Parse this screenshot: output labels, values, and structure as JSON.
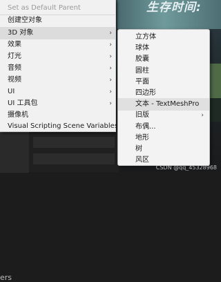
{
  "scene": {
    "title_text": "生存时间:"
  },
  "bottom_panel": {
    "label": "ers"
  },
  "watermark": "CSDN @qq_45328968",
  "main_menu": {
    "items": [
      {
        "label": "Set as Default Parent",
        "disabled": true,
        "has_submenu": false
      },
      {
        "label": "创建空对象",
        "disabled": false,
        "has_submenu": false
      },
      {
        "label": "3D 对象",
        "disabled": false,
        "has_submenu": true,
        "active": true
      },
      {
        "label": "效果",
        "disabled": false,
        "has_submenu": true
      },
      {
        "label": "灯光",
        "disabled": false,
        "has_submenu": true
      },
      {
        "label": "音频",
        "disabled": false,
        "has_submenu": true
      },
      {
        "label": "视频",
        "disabled": false,
        "has_submenu": true
      },
      {
        "label": "UI",
        "disabled": false,
        "has_submenu": true
      },
      {
        "label": "UI 工具包",
        "disabled": false,
        "has_submenu": true
      },
      {
        "label": "摄像机",
        "disabled": false,
        "has_submenu": false
      },
      {
        "label": "Visual Scripting Scene Variables",
        "disabled": false,
        "has_submenu": false
      }
    ],
    "submenu_arrow": "›"
  },
  "sub_menu": {
    "items": [
      {
        "label": "立方体",
        "has_submenu": false
      },
      {
        "label": "球体",
        "has_submenu": false
      },
      {
        "label": "胶囊",
        "has_submenu": false
      },
      {
        "label": "圆柱",
        "has_submenu": false
      },
      {
        "label": "平面",
        "has_submenu": false
      },
      {
        "label": "四边形",
        "has_submenu": false
      },
      {
        "label": "文本 - TextMeshPro",
        "has_submenu": false,
        "hover": true
      },
      {
        "label": "旧版",
        "has_submenu": true
      },
      {
        "label": "布偶...",
        "has_submenu": false
      },
      {
        "label": "地形",
        "has_submenu": false
      },
      {
        "label": "树",
        "has_submenu": false
      },
      {
        "label": "风区",
        "has_submenu": false
      }
    ],
    "submenu_arrow": "›"
  }
}
